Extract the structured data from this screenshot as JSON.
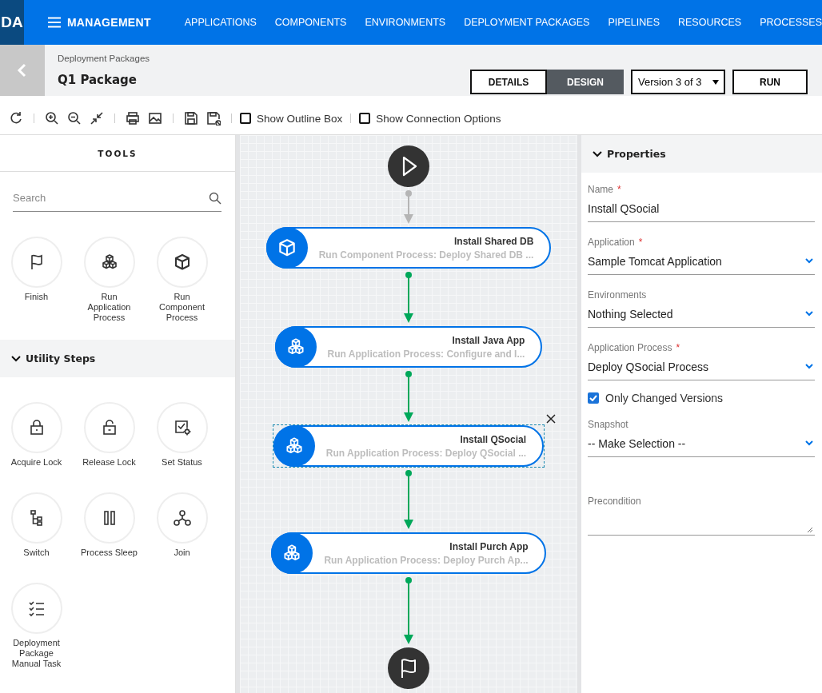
{
  "header": {
    "logo": "DA",
    "menu_label": "MANAGEMENT",
    "nav": [
      {
        "label": "APPLICATIONS"
      },
      {
        "label": "COMPONENTS"
      },
      {
        "label": "ENVIRONMENTS"
      },
      {
        "label": "DEPLOYMENT PACKAGES"
      },
      {
        "label": "PIPELINES"
      },
      {
        "label": "RESOURCES"
      },
      {
        "label": "PROCESSES"
      }
    ]
  },
  "page": {
    "breadcrumb": "Deployment Packages",
    "title": "Q1 Package",
    "view_tabs": [
      {
        "label": "DETAILS",
        "selected": false
      },
      {
        "label": "DESIGN",
        "selected": true
      }
    ],
    "version": "Version 3 of 3",
    "run_label": "RUN"
  },
  "toolbar": {
    "options": [
      {
        "label": "Show Outline Box",
        "checked": false
      },
      {
        "label": "Show Connection Options",
        "checked": false
      }
    ]
  },
  "tools": {
    "title": "TOOLS",
    "search_placeholder": "Search",
    "items": [
      {
        "kind": "flag",
        "label": "Finish"
      },
      {
        "kind": "application",
        "label": "Run Application Process"
      },
      {
        "kind": "component",
        "label": "Run Component Process"
      }
    ],
    "sections": [
      {
        "title": "Utility Steps",
        "expanded": true,
        "items": [
          {
            "kind": "lock",
            "label": "Acquire Lock"
          },
          {
            "kind": "unlock",
            "label": "Release Lock"
          },
          {
            "kind": "status",
            "label": "Set Status"
          },
          {
            "kind": "switch",
            "label": "Switch"
          },
          {
            "kind": "sleep",
            "label": "Process Sleep"
          },
          {
            "kind": "join",
            "label": "Join"
          },
          {
            "kind": "task",
            "label": "Deployment Package Manual Task"
          }
        ]
      }
    ]
  },
  "canvas": {
    "steps": [
      {
        "kind": "component",
        "title": "Install Shared DB",
        "subtitle": "Run Component Process: Deploy Shared DB ...",
        "selected": false
      },
      {
        "kind": "application",
        "title": "Install Java App",
        "subtitle": "Run Application Process: Configure and I...",
        "selected": false
      },
      {
        "kind": "application",
        "title": "Install QSocial",
        "subtitle": "Run Application Process: Deploy QSocial ...",
        "selected": true
      },
      {
        "kind": "application",
        "title": "Install Purch App",
        "subtitle": "Run Application Process: Deploy Purch Ap...",
        "selected": false
      }
    ],
    "connectors": [
      {
        "color": "#b5b5b5"
      },
      {
        "color": "#00a85a"
      },
      {
        "color": "#00a85a"
      },
      {
        "color": "#00a85a"
      },
      {
        "color": "#00a85a"
      }
    ]
  },
  "properties": {
    "title": "Properties",
    "expanded": true,
    "fields": [
      {
        "kind": "text",
        "label": "Name",
        "required_mark": "*",
        "value": "Install QSocial"
      },
      {
        "kind": "select",
        "label": "Application",
        "required_mark": "*",
        "value": "Sample Tomcat Application"
      },
      {
        "kind": "select",
        "label": "Environments",
        "value": "Nothing Selected"
      },
      {
        "kind": "select",
        "label": "Application Process",
        "required_mark": "*",
        "value": "Deploy QSocial Process"
      },
      {
        "kind": "checkbox",
        "label": "Only Changed Versions",
        "checked": true
      },
      {
        "kind": "select",
        "label": "Snapshot",
        "value": "-- Make Selection --"
      },
      {
        "kind": "textarea",
        "label": "Precondition"
      }
    ]
  }
}
